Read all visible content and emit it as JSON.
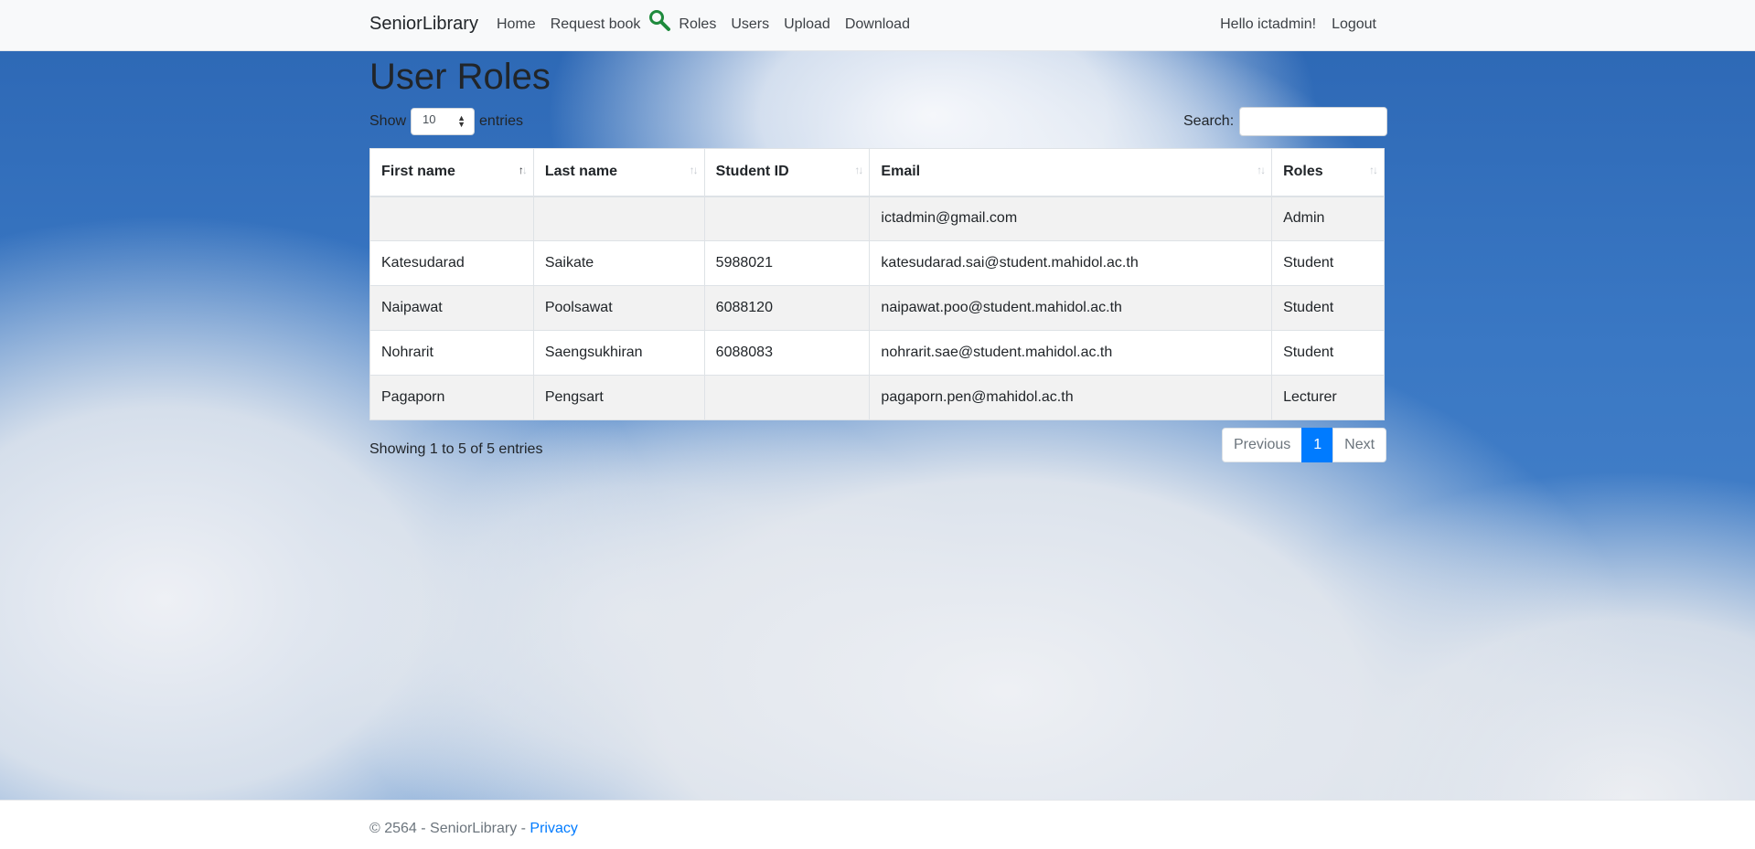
{
  "navbar": {
    "brand": "SeniorLibrary",
    "links": [
      "Home",
      "Request book",
      "Roles",
      "Users",
      "Upload",
      "Download"
    ],
    "greeting": "Hello ictadmin!",
    "logout": "Logout",
    "icon": "search-icon",
    "icon_color": "#28a745"
  },
  "page": {
    "title": "User Roles",
    "show_label": "Show",
    "entries_label": "entries",
    "page_length": "10",
    "search_label": "Search:",
    "search_value": ""
  },
  "table": {
    "columns": [
      "First name",
      "Last name",
      "Student ID",
      "Email",
      "Roles"
    ],
    "sorted_column": "First name",
    "rows": [
      [
        "",
        "",
        "",
        "ictadmin@gmail.com",
        "Admin"
      ],
      [
        "Katesudarad",
        "Saikate",
        "5988021",
        "katesudarad.sai@student.mahidol.ac.th",
        "Student"
      ],
      [
        "Naipawat",
        "Poolsawat",
        "6088120",
        "naipawat.poo@student.mahidol.ac.th",
        "Student"
      ],
      [
        "Nohrarit",
        "Saengsukhiran",
        "6088083",
        "nohrarit.sae@student.mahidol.ac.th",
        "Student"
      ],
      [
        "Pagaporn",
        "Pengsart",
        "",
        "pagaporn.pen@mahidol.ac.th",
        "Lecturer"
      ]
    ]
  },
  "info": "Showing 1 to 5 of 5 entries",
  "pagination": {
    "previous": "Previous",
    "current": "1",
    "next": "Next"
  },
  "footer": {
    "copyright": "© 2564 - SeniorLibrary - ",
    "privacy": "Privacy"
  },
  "colors": {
    "accent": "#007bff",
    "sky": "#3a78c4"
  }
}
